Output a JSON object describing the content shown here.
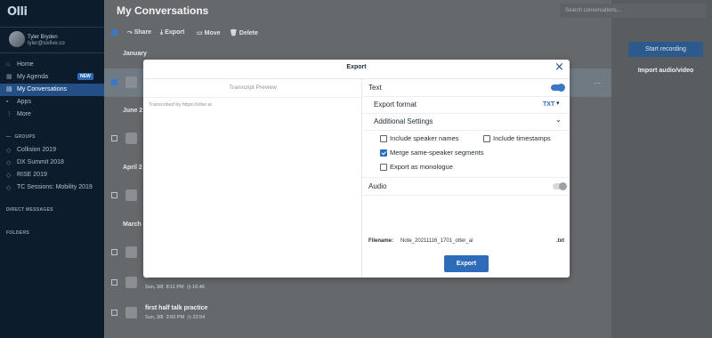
{
  "app": {
    "logo": "Olli"
  },
  "profile": {
    "name": "Tyler Bryden",
    "email": "tyler@sixlive.co"
  },
  "nav": [
    {
      "label": "Home",
      "icon": "home-icon"
    },
    {
      "label": "My Agenda",
      "icon": "calendar-icon",
      "badge": "NEW"
    },
    {
      "label": "My Conversations",
      "icon": "conversations-icon",
      "active": true
    },
    {
      "label": "Apps",
      "icon": "apps-icon"
    },
    {
      "label": "More",
      "icon": "more-icon"
    }
  ],
  "sidebar_sections": {
    "groups": "GROUPS",
    "direct_messages": "DIRECT MESSAGES",
    "folders": "FOLDERS"
  },
  "groups": [
    "Collision 2019",
    "DX Summit 2018",
    "RISE 2019",
    "TC Sessions: Mobility 2019"
  ],
  "main": {
    "title": "My Conversations",
    "toolbar": {
      "share": "Share",
      "export": "Export",
      "move": "Move",
      "delete": "Delete"
    },
    "sections": [
      "January",
      "June 2",
      "April 2",
      "March"
    ],
    "rows": [
      {
        "snippet": "...",
        "meta": "Sun, 3/8 · 8:11 PM · 16:46"
      },
      {
        "title": "first half talk practice",
        "meta_date": "Sun, 3/8",
        "meta_time": "3:50 PM",
        "meta_dur": "22:54"
      }
    ],
    "row_snippet": "...",
    "row_meta_date": "Sun, 3/8",
    "row_meta_time": "8:11 PM",
    "row_meta_dur": "16:46"
  },
  "search": {
    "placeholder": "Search conversations..."
  },
  "right": {
    "record": "Start recording",
    "import": "Import audio/video"
  },
  "modal": {
    "title": "Export",
    "transcript_preview": "Transcript Preview",
    "transcript_text": "Transcribed by https://otter.ai",
    "text_label": "Text",
    "text_enabled": true,
    "export_format_label": "Export format",
    "export_format_value": "TXT",
    "additional_settings": "Additional Settings",
    "options": [
      {
        "label": "Include speaker names",
        "checked": false
      },
      {
        "label": "Include timestamps",
        "checked": false
      },
      {
        "label": "Merge same-speaker segments",
        "checked": true
      },
      {
        "label": "Export as monologue",
        "checked": false
      }
    ],
    "audio_label": "Audio",
    "audio_enabled": false,
    "filename_label": "Filename:",
    "filename_value": "Note_20211116_1701_otter_ai",
    "filename_ext": ".txt",
    "export_button": "Export"
  },
  "colors": {
    "accent": "#2d6cb8",
    "sidebar_bg": "#0d1c2c",
    "active_nav": "#244f86"
  }
}
